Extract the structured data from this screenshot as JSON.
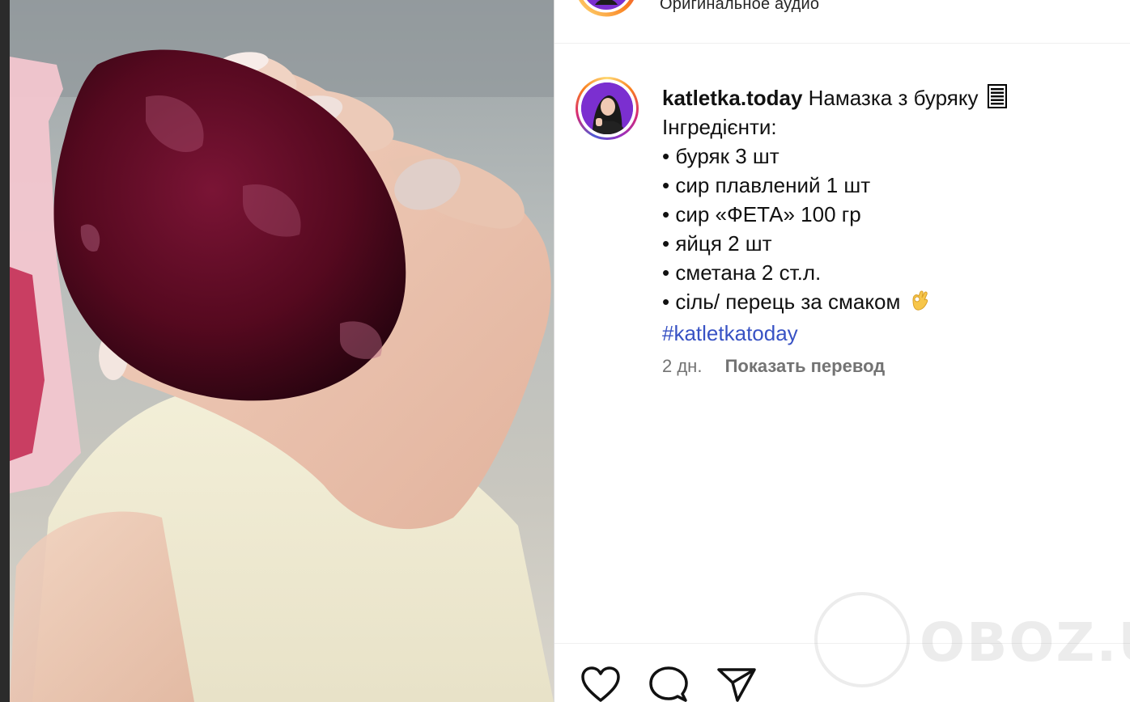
{
  "header": {
    "audio_label": "Оригинальное аудио"
  },
  "post": {
    "username": "katletka.today",
    "title": "Намазка з буряку",
    "lines": [
      "Інгредієнти:",
      "• буряк 3 шт",
      "• сир плавлений 1 шт",
      "• сир «ФЕТА» 100 гр",
      "• яйця 2 шт",
      "• сметана 2 ст.л.",
      "• сіль/ перець за смаком"
    ],
    "hashtag": "#katletkatoday",
    "time_ago": "2 дн.",
    "translate_label": "Показать перевод"
  },
  "watermark": {
    "text": "OBOZ.UA"
  },
  "icons": {
    "like": "heart-icon",
    "comment": "comment-icon",
    "share": "send-icon",
    "scroll_emoji": "scroll-emoji-icon",
    "ok_emoji": "ok-hand-emoji-icon"
  },
  "colors": {
    "hashtag": "#3852c4",
    "meta": "#737373",
    "beet": "#5a0a24"
  }
}
